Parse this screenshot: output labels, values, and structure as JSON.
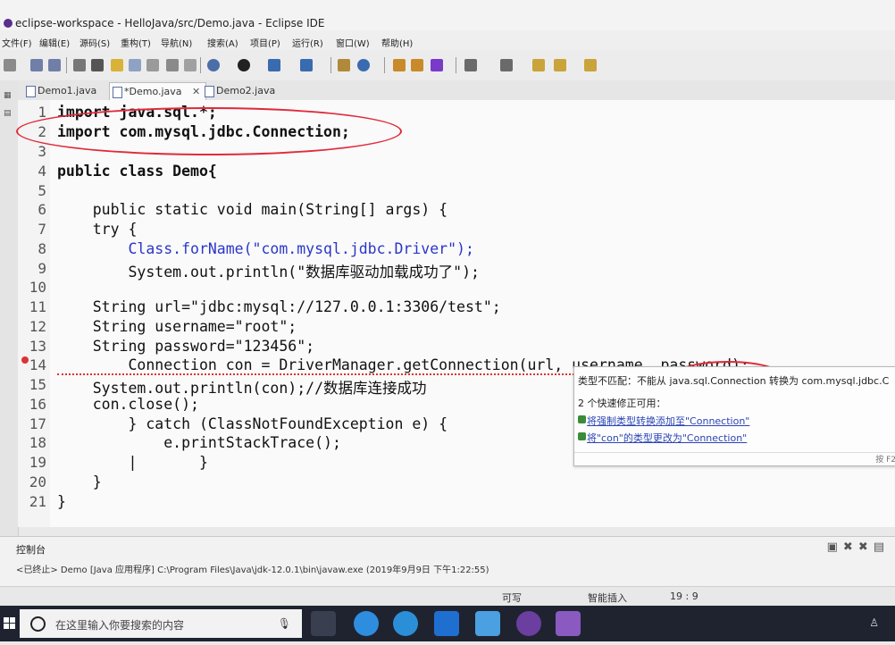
{
  "window": {
    "title": "eclipse-workspace - HelloJava/src/Demo.java - Eclipse IDE"
  },
  "menu": {
    "items": [
      "文件(F)",
      "编辑(E)",
      "源码(S)",
      "重构(T)",
      "导航(N)",
      "搜索(A)",
      "项目(P)",
      "运行(R)",
      "窗口(W)",
      "帮助(H)"
    ]
  },
  "tabs": [
    {
      "label": "Demo1.java"
    },
    {
      "label": "*Demo.java",
      "active": true
    },
    {
      "label": "Demo2.java"
    }
  ],
  "editor": {
    "lines": [
      {
        "n": "1",
        "code": "import java.sql.*;"
      },
      {
        "n": "2",
        "code": "import com.mysql.jdbc.Connection;"
      },
      {
        "n": "3",
        "code": ""
      },
      {
        "n": "4",
        "code": "public class Demo{"
      },
      {
        "n": "5",
        "code": ""
      },
      {
        "n": "6",
        "code": "    public static void main(String[] args) {"
      },
      {
        "n": "7",
        "code": "    try {"
      },
      {
        "n": "8",
        "code": "        Class.forName(\"com.mysql.jdbc.Driver\");"
      },
      {
        "n": "9",
        "code": "        System.out.println(\"数据库驱动加载成功了\");"
      },
      {
        "n": "10",
        "code": ""
      },
      {
        "n": "11",
        "code": "    String url=\"jdbc:mysql://127.0.0.1:3306/test\";"
      },
      {
        "n": "12",
        "code": "    String username=\"root\";"
      },
      {
        "n": "13",
        "code": "    String password=\"123456\";"
      },
      {
        "n": "14",
        "code": "        Connection con = DriverManager.getConnection(url, username, password);"
      },
      {
        "n": "15",
        "code": "    System.out.println(con);//数据库连接成功"
      },
      {
        "n": "16",
        "code": "    con.close();"
      },
      {
        "n": "17",
        "code": "        } catch (ClassNotFoundException e) {"
      },
      {
        "n": "18",
        "code": "            e.printStackTrace();"
      },
      {
        "n": "19",
        "code": "        |       }"
      },
      {
        "n": "20",
        "code": "    }"
      },
      {
        "n": "21",
        "code": "}"
      }
    ]
  },
  "hover": {
    "header": "类型不匹配：不能从 java.sql.Connection 转换为 com.mysql.jdbc.C",
    "subtitle": "2 个快速修正可用：",
    "fixes": [
      "将强制类型转换添加至\"Connection\"",
      "将\"con\"的类型更改为\"Connection\""
    ],
    "footer": "按 F2"
  },
  "console": {
    "title": "控制台",
    "line": "<已终止> Demo [Java 应用程序] C:\\Program Files\\Java\\jdk-12.0.1\\bin\\javaw.exe  (2019年9月9日 下午1:22:55)"
  },
  "status": {
    "writable": "可写",
    "insert_mode": "智能插入",
    "position": "19 : 9"
  },
  "taskbar": {
    "search_placeholder": "在这里输入你要搜索的内容"
  }
}
